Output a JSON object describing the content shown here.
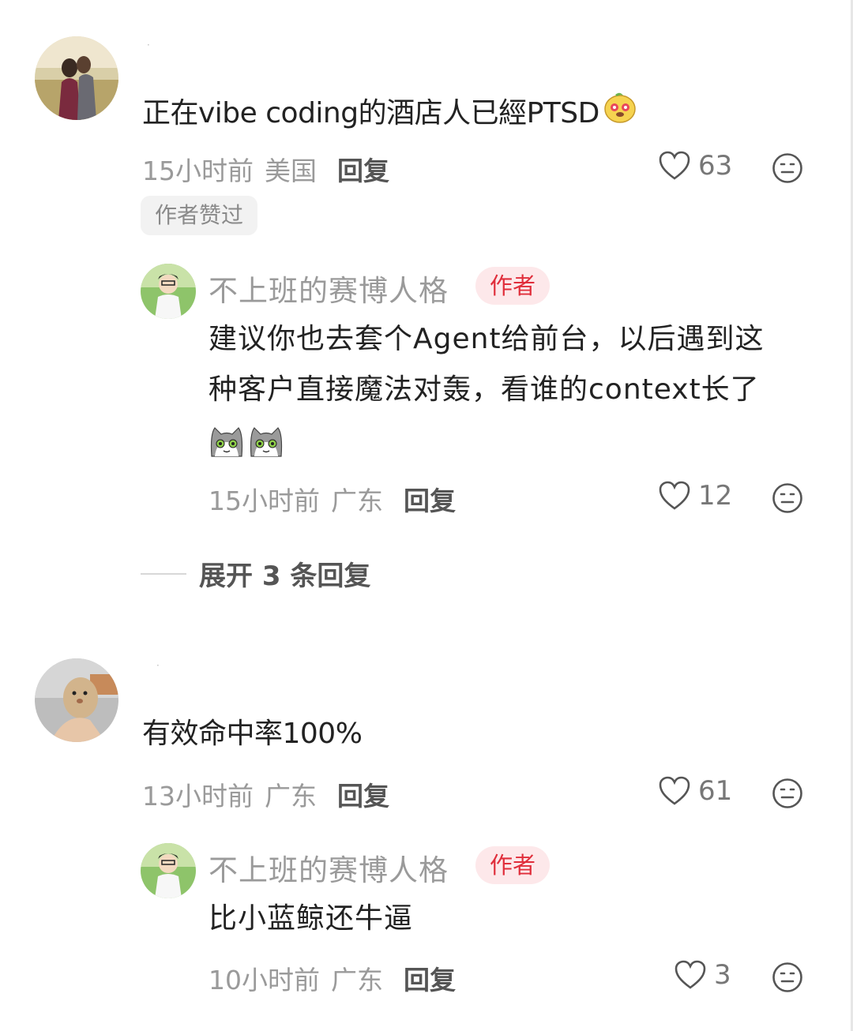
{
  "comments": [
    {
      "text": "正在vibe coding的酒店人已經PTSD",
      "time": "15小时前",
      "location": "美国",
      "reply_label": "回复",
      "likes": "63",
      "author_liked": "作者赞过",
      "replies": [
        {
          "username": "不上班的赛博人格",
          "badge": "作者",
          "text_line1": "建议你也去套个Agent给前台，以后遇到这",
          "text_line2": "种客户直接魔法对轰，看谁的context长了",
          "time": "15小时前",
          "location": "广东",
          "reply_label": "回复",
          "likes": "12"
        }
      ],
      "expand_label": "展开 3 条回复"
    },
    {
      "text": "有效命中率100%",
      "time": "13小时前",
      "location": "广东",
      "reply_label": "回复",
      "likes": "61",
      "replies": [
        {
          "username": "不上班的赛博人格",
          "badge": "作者",
          "text_line1": "比小蓝鲸还牛逼",
          "time": "10小时前",
          "location": "广东",
          "reply_label": "回复",
          "likes": "3"
        }
      ]
    }
  ],
  "icons": {
    "like": "heart-outline-icon",
    "dislike": "neutral-face-icon",
    "sticker_dog": "dog-emoji-icon",
    "sticker_cat": "cat-emoji-icon"
  },
  "colors": {
    "badge_bg": "#fde8ea",
    "badge_text": "#e02e3b",
    "meta_gray": "#9a9a9a"
  }
}
